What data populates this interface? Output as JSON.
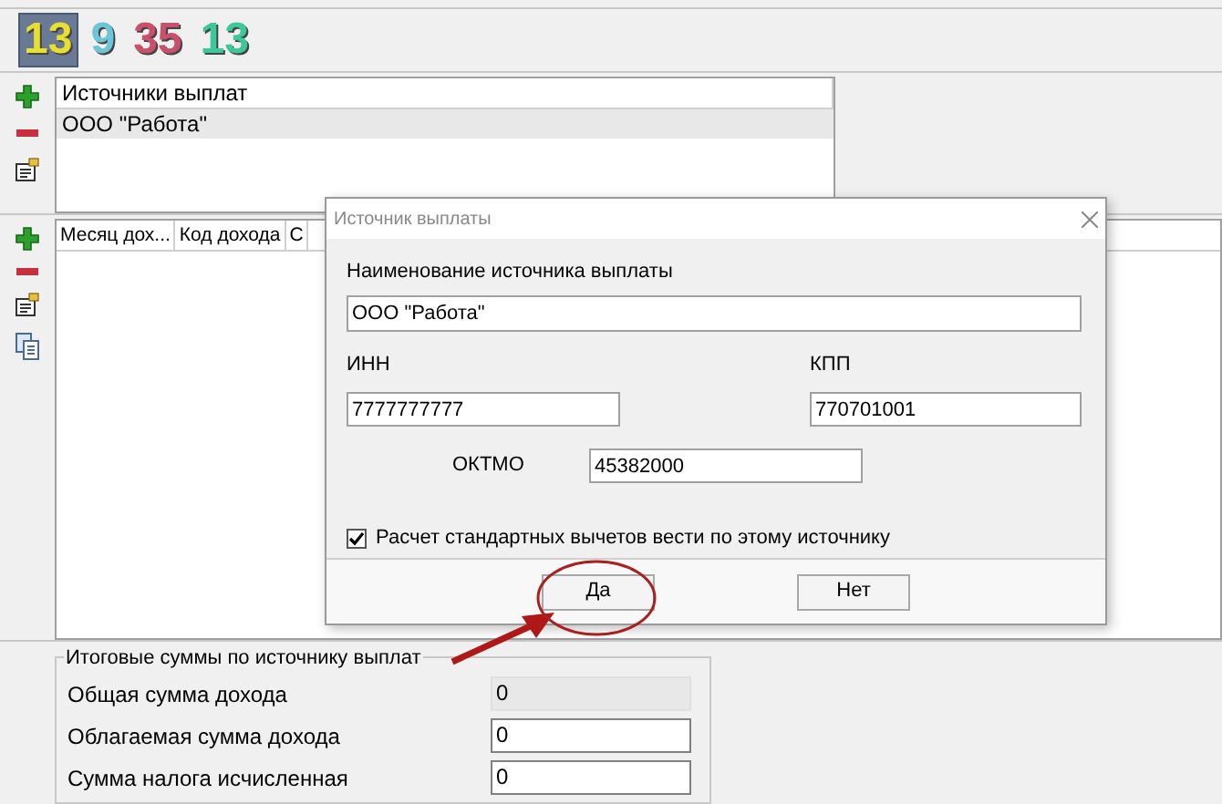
{
  "toolbar": {
    "counters": [
      {
        "text": "13",
        "color": "#e8e030",
        "selected": true
      },
      {
        "text": "9",
        "color": "#6cc6d8",
        "selected": false
      },
      {
        "text": "35",
        "color": "#c8506a",
        "selected": false
      },
      {
        "text": "13",
        "color": "#3cc89a",
        "selected": false
      }
    ]
  },
  "sources": {
    "columns": [
      "Источники выплат"
    ],
    "rows": [
      {
        "name": "ООО \"Работа\"",
        "selected": true
      }
    ]
  },
  "income": {
    "columns": [
      "Месяц дох...",
      "Код дохода",
      "С"
    ]
  },
  "dialog": {
    "title": "Источник выплаты",
    "name_label": "Наименование источника выплаты",
    "name_value": "ООО \"Работа\"",
    "inn_label": "ИНН",
    "inn_value": "7777777777",
    "kpp_label": "КПП",
    "kpp_value": "770701001",
    "oktmo_label": "ОКТМО",
    "oktmo_value": "45382000",
    "checkbox": {
      "label": "Расчет стандартных вычетов вести по этому источнику",
      "checked": true
    },
    "buttons": [
      "Да",
      "Нет"
    ]
  },
  "totals": {
    "title": "Итоговые суммы по источнику выплат",
    "rows": [
      {
        "label": "Общая сумма дохода",
        "value": "0",
        "disabled": true
      },
      {
        "label": "Облагаемая сумма дохода",
        "value": "0",
        "disabled": false
      },
      {
        "label": "Сумма налога исчисленная",
        "value": "0",
        "disabled": false
      }
    ]
  }
}
